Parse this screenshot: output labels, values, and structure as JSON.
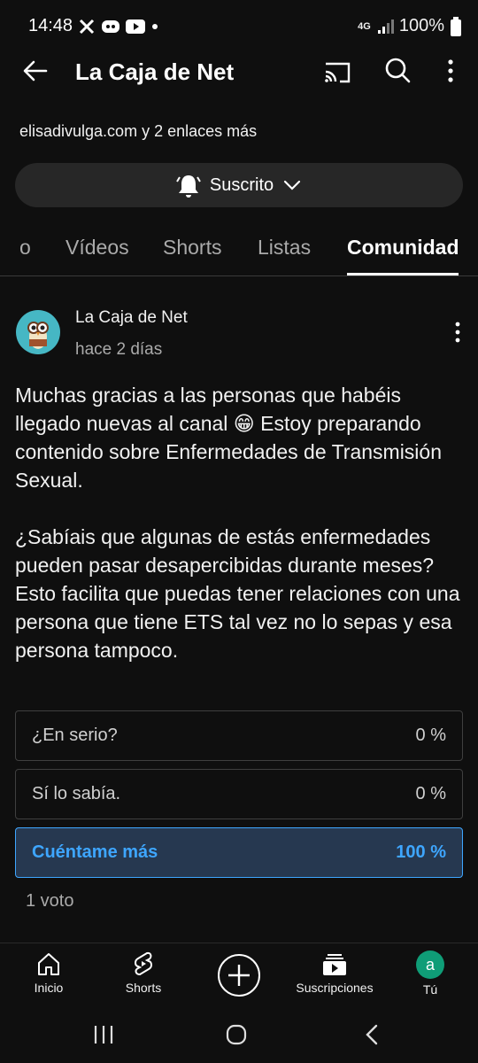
{
  "status": {
    "time": "14:48",
    "network": "4G",
    "battery": "100%"
  },
  "app_bar": {
    "title": "La Caja de Net"
  },
  "channel": {
    "links": "elisadivulga.com y 2 enlaces más",
    "subscribed_label": "Suscrito"
  },
  "tabs": [
    {
      "label": "o"
    },
    {
      "label": "Vídeos"
    },
    {
      "label": "Shorts"
    },
    {
      "label": "Listas"
    },
    {
      "label": "Comunidad",
      "active": true
    }
  ],
  "post": {
    "author": "La Caja de Net",
    "time": "hace 2 días",
    "text": "Muchas gracias a las personas que habéis llegado nuevas al canal 😁 Estoy preparando contenido sobre Enfermedades de Transmisión Sexual.\n\n¿Sabíais que algunas de estás enfermedades pueden pasar desapercibidas durante meses? Esto facilita que puedas tener relaciones con una persona que tiene ETS tal vez no lo sepas y esa persona tampoco."
  },
  "poll": {
    "options": [
      {
        "label": "¿En serio?",
        "percent": "0 %"
      },
      {
        "label": "Sí lo sabía.",
        "percent": "0 %"
      },
      {
        "label": "Cuéntame más",
        "percent": "100 %",
        "selected": true
      }
    ],
    "votes": "1 voto"
  },
  "bottom_nav": {
    "home": "Inicio",
    "shorts": "Shorts",
    "subscriptions": "Suscripciones",
    "you": "Tú",
    "you_avatar_letter": "a"
  },
  "colors": {
    "accent": "#3ea6ff",
    "selected_bg": "#263850",
    "background": "#0f0f0f"
  }
}
